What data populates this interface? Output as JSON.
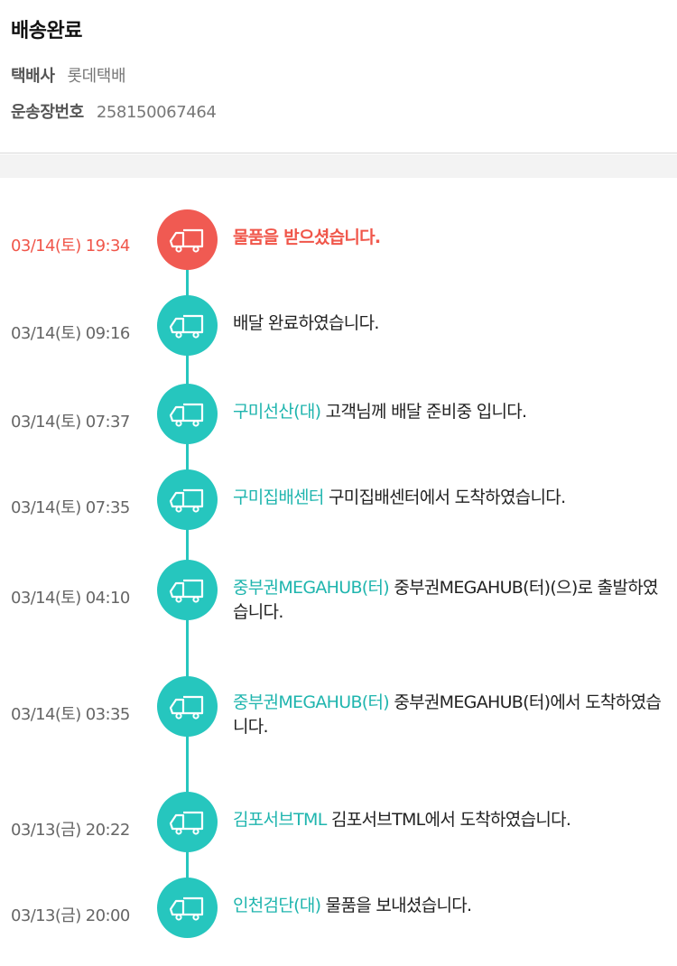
{
  "header": {
    "status_title": "배송완료",
    "carrier_label": "택배사",
    "carrier_value": "롯데택배",
    "tracking_label": "운송장번호",
    "tracking_value": "258150067464"
  },
  "colors": {
    "accent_teal": "#26c6be",
    "location_text": "#1fb5ae",
    "active_red": "#f05a52",
    "band_gray": "#f3f3f3"
  },
  "events": [
    {
      "time": "03/14(토) 19:34",
      "location": "",
      "message": "물품을 받으셨습니다.",
      "icon": "truck-icon"
    },
    {
      "time": "03/14(토) 09:16",
      "location": "",
      "message": "배달 완료하였습니다.",
      "icon": "truck-icon"
    },
    {
      "time": "03/14(토) 07:37",
      "location": "구미선산(대)",
      "message": "고객님께 배달 준비중 입니다.",
      "icon": "truck-icon"
    },
    {
      "time": "03/14(토) 07:35",
      "location": "구미집배센터",
      "message": "구미집배센터에서 도착하였습니다.",
      "icon": "truck-icon"
    },
    {
      "time": "03/14(토) 04:10",
      "location": "중부권MEGAHUB(터)",
      "message": "중부권MEGAHUB(터)(으)로 출발하였습니다.",
      "icon": "truck-icon"
    },
    {
      "time": "03/14(토) 03:35",
      "location": "중부권MEGAHUB(터)",
      "message": "중부권MEGAHUB(터)에서 도착하였습니다.",
      "icon": "truck-icon"
    },
    {
      "time": "03/13(금) 20:22",
      "location": "김포서브TML",
      "message": "김포서브TML에서 도착하였습니다.",
      "icon": "truck-icon"
    },
    {
      "time": "03/13(금) 20:00",
      "location": "인천검단(대)",
      "message": "물품을 보내셨습니다.",
      "icon": "truck-icon"
    }
  ]
}
